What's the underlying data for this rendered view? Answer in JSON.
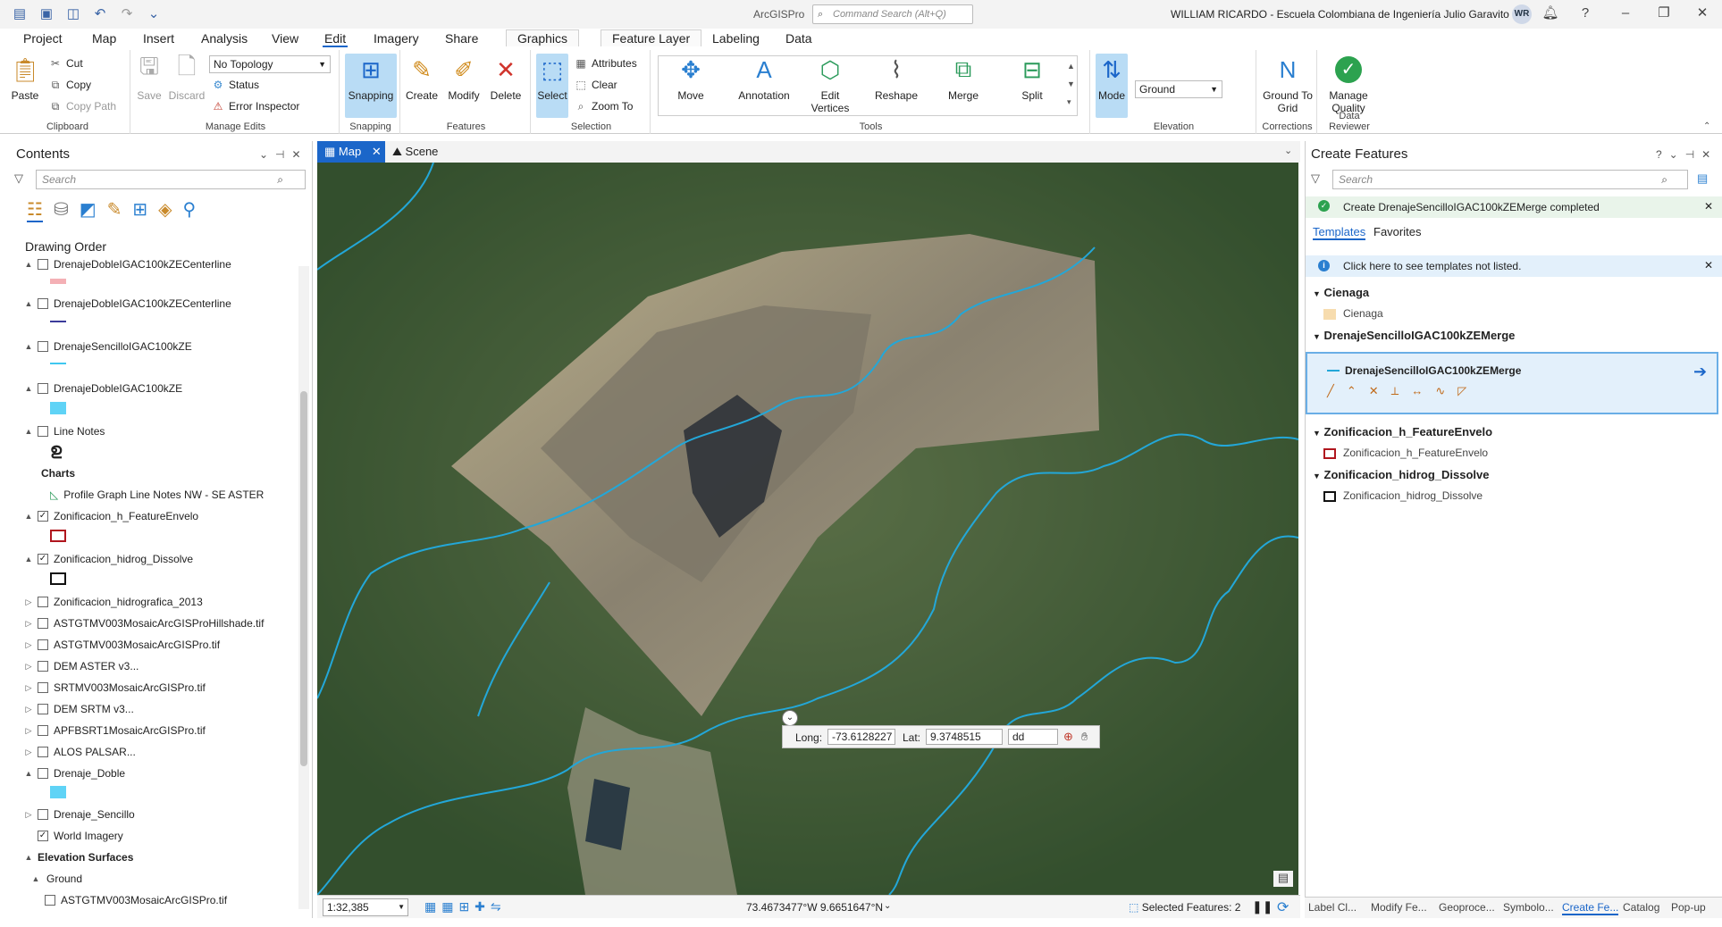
{
  "app": {
    "title": "ArcGISPro",
    "command_search": "Command Search (Alt+Q)",
    "user": "WILLIAM RICARDO  - Escuela Colombiana de Ingeniería Julio Garavito",
    "avatar": "WR"
  },
  "tabs": [
    "Project",
    "Map",
    "Insert",
    "Analysis",
    "View",
    "Edit",
    "Imagery",
    "Share",
    "Graphics",
    "Feature Layer",
    "Labeling",
    "Data"
  ],
  "ribbon": {
    "clipboard": {
      "paste": "Paste",
      "cut": "Cut",
      "copy": "Copy",
      "copy_path": "Copy Path",
      "label": "Clipboard"
    },
    "manage_edits": {
      "save": "Save",
      "discard": "Discard",
      "topology": "No Topology",
      "status": "Status",
      "error_inspector": "Error Inspector",
      "label": "Manage Edits"
    },
    "snapping": {
      "snapping": "Snapping",
      "label": "Snapping"
    },
    "features": {
      "create": "Create",
      "modify": "Modify",
      "delete": "Delete",
      "label": "Features"
    },
    "selection": {
      "select": "Select",
      "attributes": "Attributes",
      "clear": "Clear",
      "zoom_to": "Zoom To",
      "label": "Selection"
    },
    "tools": {
      "items": [
        "Move",
        "Annotation",
        "Edit Vertices",
        "Reshape",
        "Merge",
        "Split"
      ],
      "label": "Tools"
    },
    "elevation": {
      "mode": "Mode",
      "surface": "Ground",
      "label": "Elevation"
    },
    "corrections": {
      "ground_to_grid": "Ground To Grid",
      "label": "Corrections"
    },
    "data_reviewer": {
      "manage_quality": "Manage Quality",
      "label": "Data Reviewer"
    }
  },
  "contents": {
    "title": "Contents",
    "search_placeholder": "Search",
    "drawing_order": "Drawing Order",
    "layers": [
      {
        "name": "DrenajeDobleIGAC100kZECenterline",
        "checked": false,
        "twisty": "▲"
      },
      {
        "name": "DrenajeDobleIGAC100kZECenterline",
        "checked": false,
        "twisty": "▲"
      },
      {
        "name": "DrenajeSencilloIGAC100kZE",
        "checked": false,
        "twisty": "▲"
      },
      {
        "name": "DrenajeDobleIGAC100kZE",
        "checked": false,
        "twisty": "▲"
      },
      {
        "name": "Line Notes",
        "checked": false,
        "twisty": "▲"
      },
      {
        "name": "Charts",
        "checked": null,
        "twisty": ""
      },
      {
        "name": "Profile Graph Line Notes NW - SE ASTER",
        "checked": null,
        "twisty": ""
      },
      {
        "name": "Zonificacion_h_FeatureEnvelo",
        "checked": true,
        "twisty": "▲"
      },
      {
        "name": "Zonificacion_hidrog_Dissolve",
        "checked": true,
        "twisty": "▲"
      },
      {
        "name": "Zonificacion_hidrografica_2013",
        "checked": false,
        "twisty": "▷"
      },
      {
        "name": "ASTGTMV003MosaicArcGISProHillshade.tif",
        "checked": false,
        "twisty": "▷"
      },
      {
        "name": "ASTGTMV003MosaicArcGISPro.tif",
        "checked": false,
        "twisty": "▷"
      },
      {
        "name": "DEM ASTER v3...",
        "checked": false,
        "twisty": "▷"
      },
      {
        "name": "SRTMV003MosaicArcGISPro.tif",
        "checked": false,
        "twisty": "▷"
      },
      {
        "name": "DEM SRTM v3...",
        "checked": false,
        "twisty": "▷"
      },
      {
        "name": "APFBSRT1MosaicArcGISPro.tif",
        "checked": false,
        "twisty": "▷"
      },
      {
        "name": "ALOS PALSAR...",
        "checked": false,
        "twisty": "▷"
      },
      {
        "name": "Drenaje_Doble",
        "checked": false,
        "twisty": "▲"
      },
      {
        "name": "Drenaje_Sencillo",
        "checked": false,
        "twisty": "▷"
      },
      {
        "name": "World Imagery",
        "checked": true,
        "twisty": ""
      },
      {
        "name": "Elevation Surfaces",
        "checked": null,
        "twisty": "▲"
      },
      {
        "name": "Ground",
        "checked": null,
        "twisty": "▲"
      },
      {
        "name": "ASTGTMV003MosaicArcGISPro.tif",
        "checked": false,
        "twisty": ""
      }
    ]
  },
  "map": {
    "tabs": [
      "Map",
      "Scene"
    ],
    "scale": "1:32,385",
    "coords": "73.4673477°W 9.6651647°N",
    "long_label": "Long:",
    "long_value": "-73.6128227",
    "lat_label": "Lat:",
    "lat_value": "9.3748515",
    "units": "dd",
    "selected_features": "Selected Features: 2"
  },
  "create_features": {
    "title": "Create Features",
    "search_placeholder": "Search",
    "message": "Create DrenajeSencilloIGAC100kZEMerge completed",
    "tabs": [
      "Templates",
      "Favorites"
    ],
    "info": "Click here to see templates not listed.",
    "groups": [
      {
        "name": "Cienaga",
        "items": [
          "Cienaga"
        ]
      },
      {
        "name": "DrenajeSencilloIGAC100kZEMerge",
        "items": [
          "DrenajeSencilloIGAC100kZEMerge"
        ]
      },
      {
        "name": "Zonificacion_h_FeatureEnvelo",
        "items": [
          "Zonificacion_h_FeatureEnvelo"
        ]
      },
      {
        "name": "Zonificacion_hidrog_Dissolve",
        "items": [
          "Zonificacion_hidrog_Dissolve"
        ]
      }
    ]
  },
  "bottom_tabs": [
    "Label Cl...",
    "Modify Fe...",
    "Geoproce...",
    "Symbolo...",
    "Create Fe...",
    "Catalog",
    "Pop-up"
  ],
  "colors": {
    "accent": "#1b66c9",
    "water": "#23a7d8",
    "selected_bg": "#b9dcf5"
  }
}
